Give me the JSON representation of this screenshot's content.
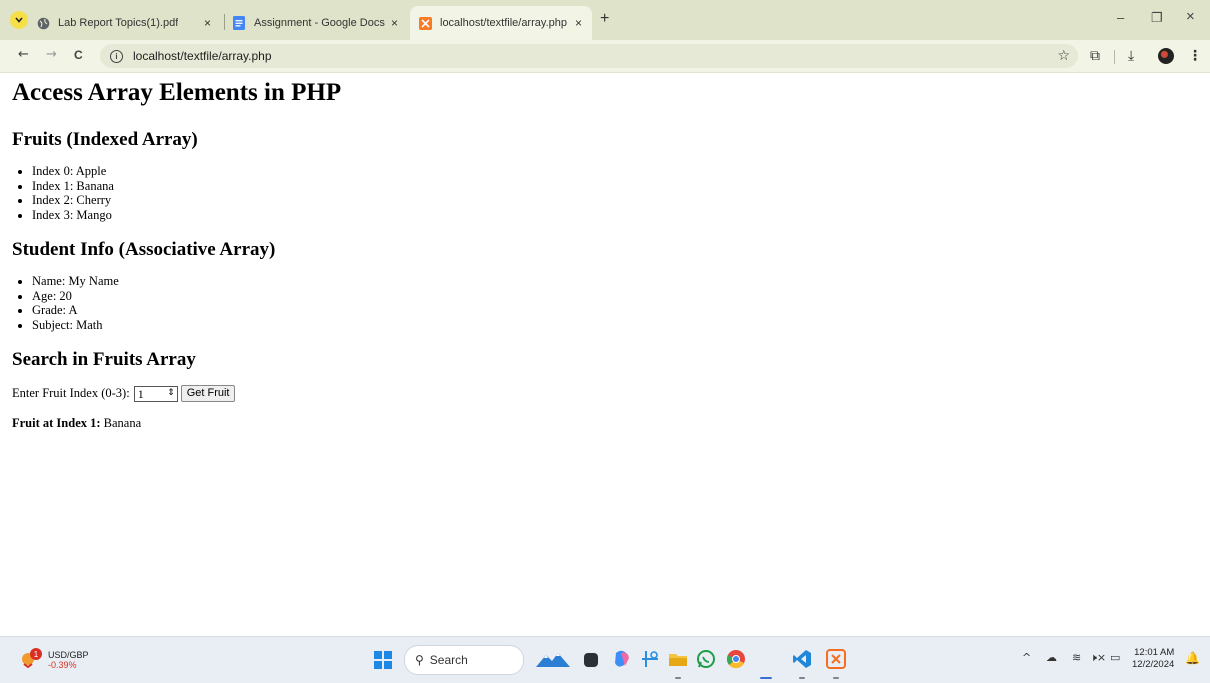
{
  "browser": {
    "tabs": [
      {
        "title": "Lab Report Topics(1).pdf",
        "close": "×"
      },
      {
        "title": "Assignment - Google Docs",
        "close": "×"
      },
      {
        "title": "localhost/textfile/array.php",
        "close": "×"
      }
    ],
    "new_tab": "+",
    "window_controls": {
      "minimize": "–",
      "restore": "❐",
      "close": "×"
    },
    "nav": {
      "back": "←",
      "forward": "→",
      "reload": "C"
    },
    "url": "localhost/textfile/array.php",
    "toolbar_icons": {
      "star": "☆",
      "extensions": "⧉",
      "download": "⤓",
      "menu": "⋮"
    }
  },
  "page": {
    "title": "Access Array Elements in PHP",
    "fruits_heading": "Fruits (Indexed Array)",
    "fruits": [
      "Index 0: Apple",
      "Index 1: Banana",
      "Index 2: Cherry",
      "Index 3: Mango"
    ],
    "student_heading": "Student Info (Associative Array)",
    "student": [
      "Name: My Name",
      "Age: 20",
      "Grade: A",
      "Subject: Math"
    ],
    "search_heading": "Search in Fruits Array",
    "search_label": "Enter Fruit Index (0-3):",
    "search_value": "1",
    "search_button": "Get Fruit",
    "result_label": "Fruit at Index 1:",
    "result_value": "Banana"
  },
  "taskbar": {
    "ticker_badge": "1",
    "ticker_name": "USD/GBP",
    "ticker_change": "-0.39%",
    "search_placeholder": "Search",
    "time": "12:01 AM",
    "date": "12/2/2024",
    "tray_icons": {
      "chevron": "^",
      "wifi": "≋",
      "mute": "🕨×",
      "battery": "▭"
    }
  },
  "colors": {
    "tabbar_bg": "#dfe3c9",
    "toolbar_bg": "#f2f4e6",
    "taskbar_bg": "#e9eef4",
    "ticker_negative": "#d93025"
  }
}
